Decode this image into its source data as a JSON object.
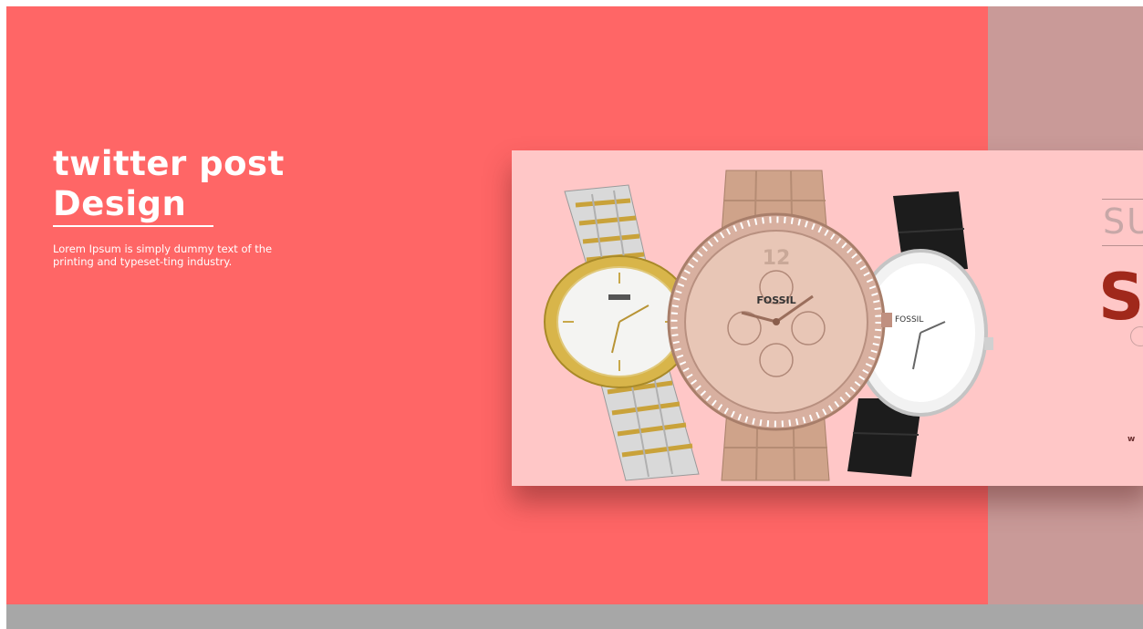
{
  "hero": {
    "title_line1": "twitter post",
    "title_line2": "Design",
    "description": "Lorem Ipsum is simply dummy text of the printing and typeset-ting industry."
  },
  "card": {
    "brand_on_dial": "FOSSIL",
    "brand_on_small_dial": "FOSSIL",
    "heading_partial": "SU",
    "sale_partial": "S",
    "url_partial": "w w"
  },
  "colors": {
    "coral": "#ff6666",
    "mauve": "#c99a98",
    "card_pink": "#ffc7c7",
    "bottom_bar": "#a7a7a7",
    "accent_red": "#a0281b"
  },
  "icons": [
    "watch-image",
    "circle-ring-icon"
  ]
}
